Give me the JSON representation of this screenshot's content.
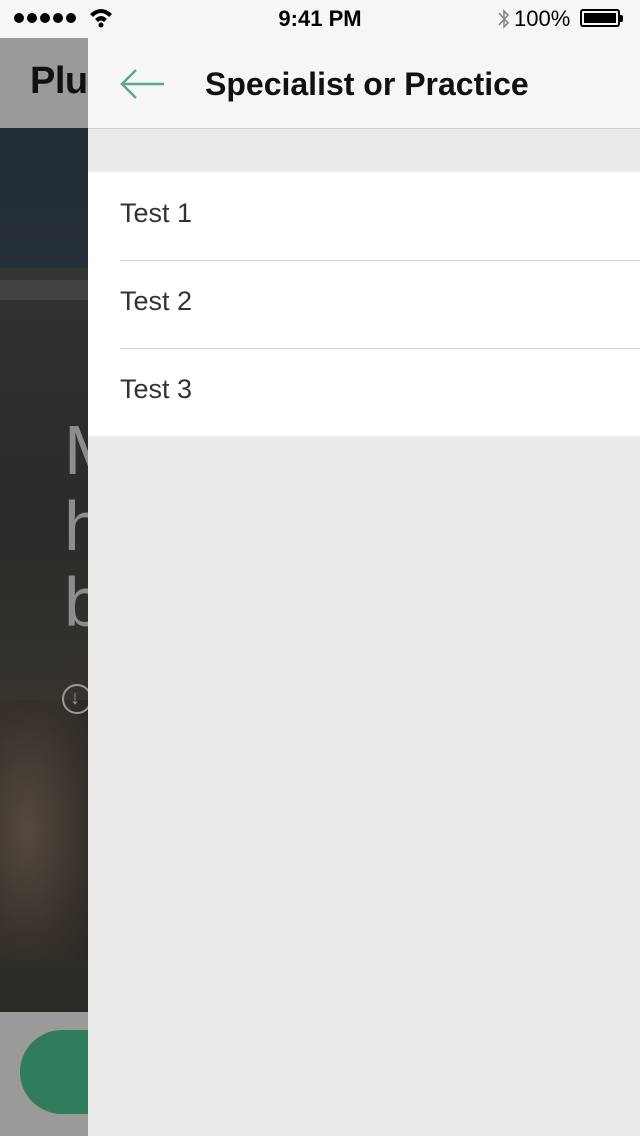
{
  "background_app": {
    "title": "Plu",
    "hero_text": "M\nh\nb"
  },
  "status_bar": {
    "time": "9:41 PM",
    "battery": "100%"
  },
  "panel": {
    "title": "Specialist or Practice",
    "items": [
      {
        "label": "Test 1"
      },
      {
        "label": "Test 2"
      },
      {
        "label": "Test 3"
      }
    ]
  },
  "colors": {
    "accent": "#5aa88a",
    "cta": "#2f7d5c"
  }
}
